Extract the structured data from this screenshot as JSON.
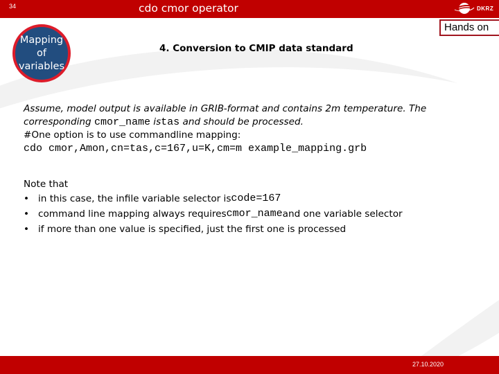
{
  "header": {
    "slide_number": "34",
    "title": "cdo cmor operator",
    "logo_text": "DKRZ",
    "hands_on_label": "Hands on"
  },
  "badge": {
    "lines": [
      "Mapping",
      "of",
      "variables"
    ]
  },
  "subtitle": "4. Conversion to CMIP data standard",
  "body": {
    "line1": "Assume, model output is available in GRIB-format and contains 2m temperature. The",
    "line2_prefix": "corresponding ",
    "line2_code1": "cmor_name",
    "line2_mid": " is",
    "line2_code2": "tas",
    "line2_suffix": " and should be processed.",
    "line3": "#One option is to use commandline mapping:",
    "command": "cdo cmor,Amon,cn=tas,c=167,u=K,cm=m example_mapping.grb"
  },
  "notes": {
    "heading": "Note that",
    "bullet_symbol": "•",
    "items": [
      {
        "text": "in this case, the infile variable selector is ",
        "code": "code=167",
        "after": ""
      },
      {
        "text": "command line mapping always requires ",
        "code": "cmor_name",
        "after": " and one variable selector"
      },
      {
        "text": "if more than one value is specified, just the first one is processed",
        "code": "",
        "after": ""
      }
    ]
  },
  "footer": {
    "date": "27.10.2020"
  },
  "colors": {
    "brand_red": "#c00000",
    "badge_blue": "#224d7f",
    "badge_border": "#dd1c2a"
  }
}
